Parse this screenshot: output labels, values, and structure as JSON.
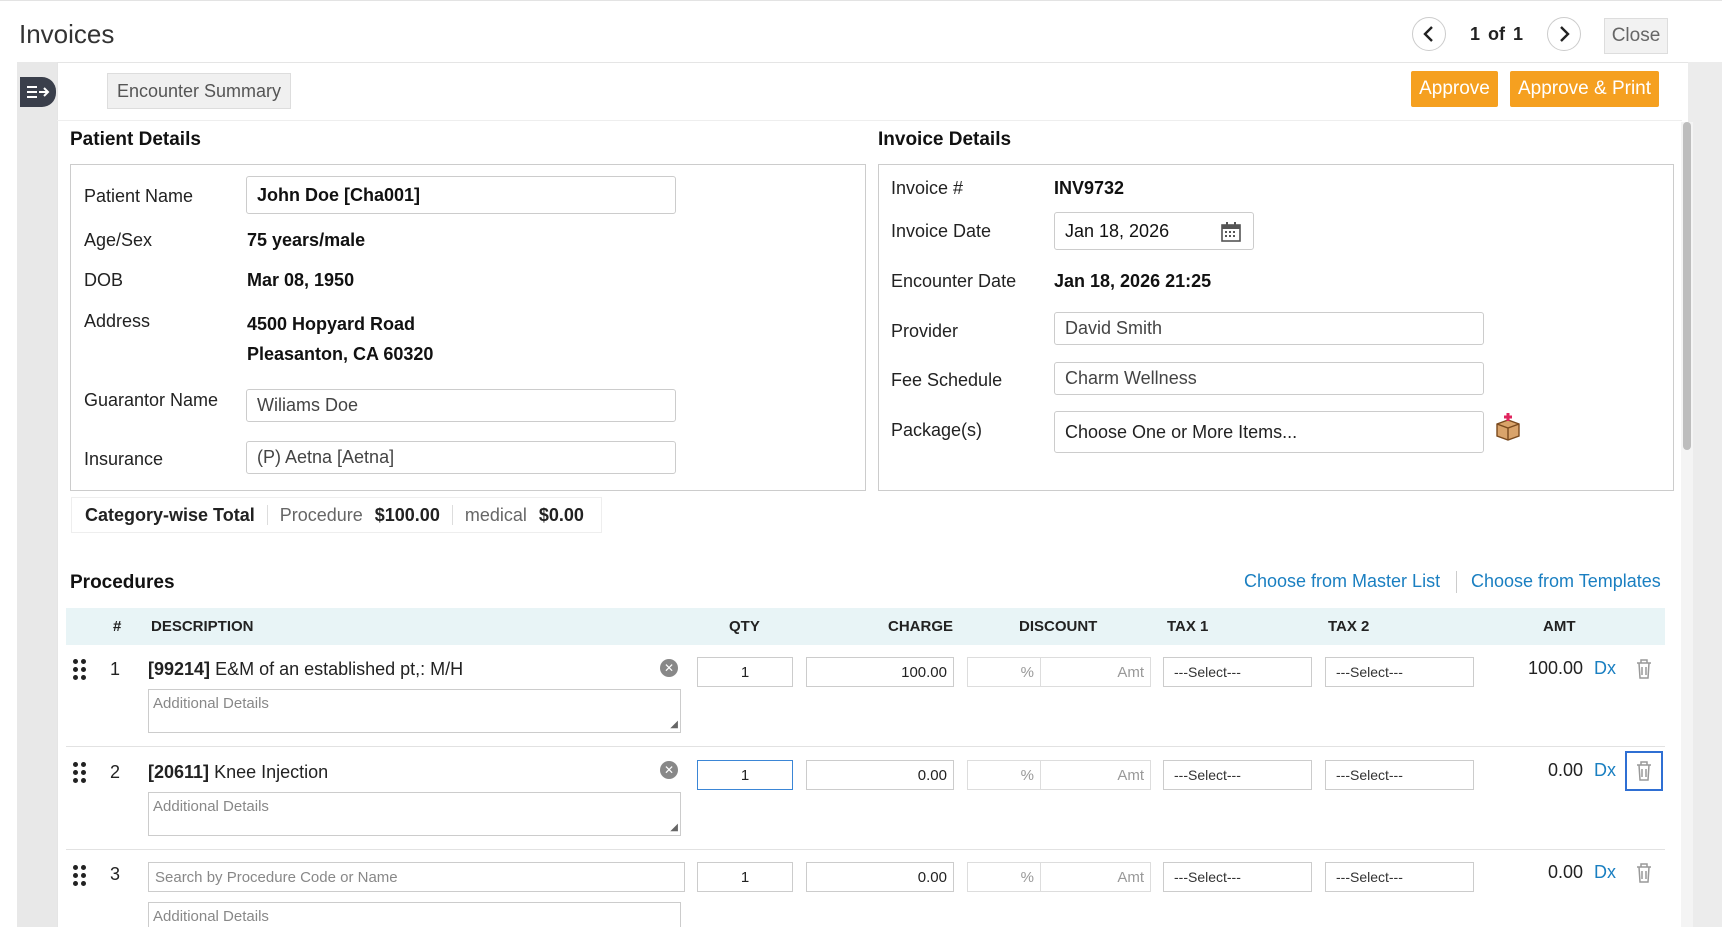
{
  "header": {
    "title": "Invoices",
    "pager": {
      "current": "1",
      "of": "of",
      "total": "1"
    },
    "close_label": "Close"
  },
  "toolbar": {
    "encounter_summary": "Encounter Summary",
    "approve": "Approve",
    "approve_print": "Approve & Print"
  },
  "patient": {
    "section_title": "Patient Details",
    "name_label": "Patient Name",
    "name": "John Doe [Cha001]",
    "age_label": "Age/Sex",
    "age": "75 years/male",
    "dob_label": "DOB",
    "dob": "Mar 08, 1950",
    "address_label": "Address",
    "address_line1": "4500 Hopyard Road",
    "address_line2": "Pleasanton, CA 60320",
    "guarantor_label": "Guarantor Name",
    "guarantor": "Wiliams Doe",
    "insurance_label": "Insurance",
    "insurance": "(P) Aetna [Aetna]"
  },
  "invoice": {
    "section_title": "Invoice Details",
    "number_label": "Invoice #",
    "number": "INV9732",
    "date_label": "Invoice Date",
    "date": "Jan 18, 2026",
    "encounter_label": "Encounter Date",
    "encounter_date": "Jan 18, 2026 21:25",
    "provider_label": "Provider",
    "provider": "David Smith",
    "fee_label": "Fee Schedule",
    "fee_schedule": "Charm Wellness",
    "package_label": "Package(s)",
    "package_placeholder": "Choose One or More Items..."
  },
  "category_total": {
    "label": "Category-wise Total",
    "items": [
      {
        "name": "Procedure",
        "amount": "$100.00"
      },
      {
        "name": "medical",
        "amount": "$0.00"
      }
    ]
  },
  "procedures": {
    "title": "Procedures",
    "master_link": "Choose from Master List",
    "templates_link": "Choose from Templates",
    "columns": [
      "#",
      "DESCRIPTION",
      "QTY",
      "CHARGE",
      "DISCOUNT",
      "TAX 1",
      "TAX 2",
      "AMT"
    ],
    "details_placeholder": "Additional Details",
    "search_placeholder": "Search by Procedure Code or Name",
    "pct_placeholder": "%",
    "amt_placeholder": "Amt",
    "select_placeholder": "---Select---",
    "dx_label": "Dx",
    "rows": [
      {
        "num": "1",
        "code": "[99214]",
        "name": "E&M of an established pt,: M/H",
        "qty": "1",
        "charge": "100.00",
        "amount": "100.00"
      },
      {
        "num": "2",
        "code": "[20611]",
        "name": "Knee Injection",
        "qty": "1",
        "charge": "0.00",
        "amount": "0.00"
      },
      {
        "num": "3",
        "code": "",
        "name": "",
        "qty": "1",
        "charge": "0.00",
        "amount": "0.00"
      }
    ]
  },
  "colors": {
    "accent_orange": "#f5a020",
    "link_blue": "#1a7fc1",
    "table_head": "#e8f4f6"
  }
}
